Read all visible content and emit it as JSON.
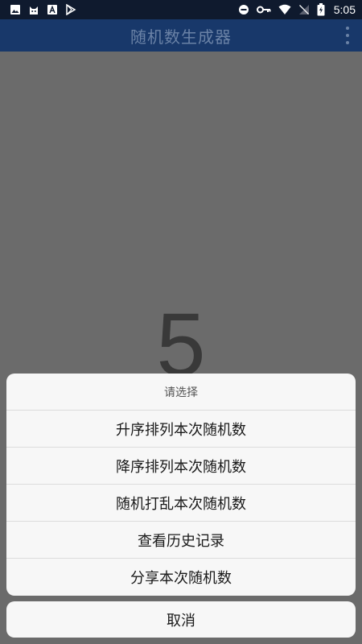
{
  "status_bar": {
    "time": "5:05",
    "left_icons": [
      "image-icon",
      "cat-icon",
      "font-icon",
      "play-store-icon"
    ],
    "right_icons": [
      "do-not-disturb-icon",
      "key-icon",
      "wifi-icon",
      "no-signal-icon",
      "battery-charging-icon"
    ]
  },
  "app_bar": {
    "title": "随机数生成器",
    "menu_icon": "overflow-menu-icon"
  },
  "result": {
    "value": "5"
  },
  "action_sheet": {
    "title": "请选择",
    "items": [
      {
        "label": "升序排列本次随机数"
      },
      {
        "label": "降序排列本次随机数"
      },
      {
        "label": "随机打乱本次随机数"
      },
      {
        "label": "查看历史记录"
      },
      {
        "label": "分享本次随机数"
      }
    ],
    "cancel_label": "取消"
  },
  "colors": {
    "status_bar_bg": "#0f1a2e",
    "app_bar_bg": "#18386a",
    "scrim": "#6b6b6b",
    "sheet_bg": "#f7f7f7"
  }
}
